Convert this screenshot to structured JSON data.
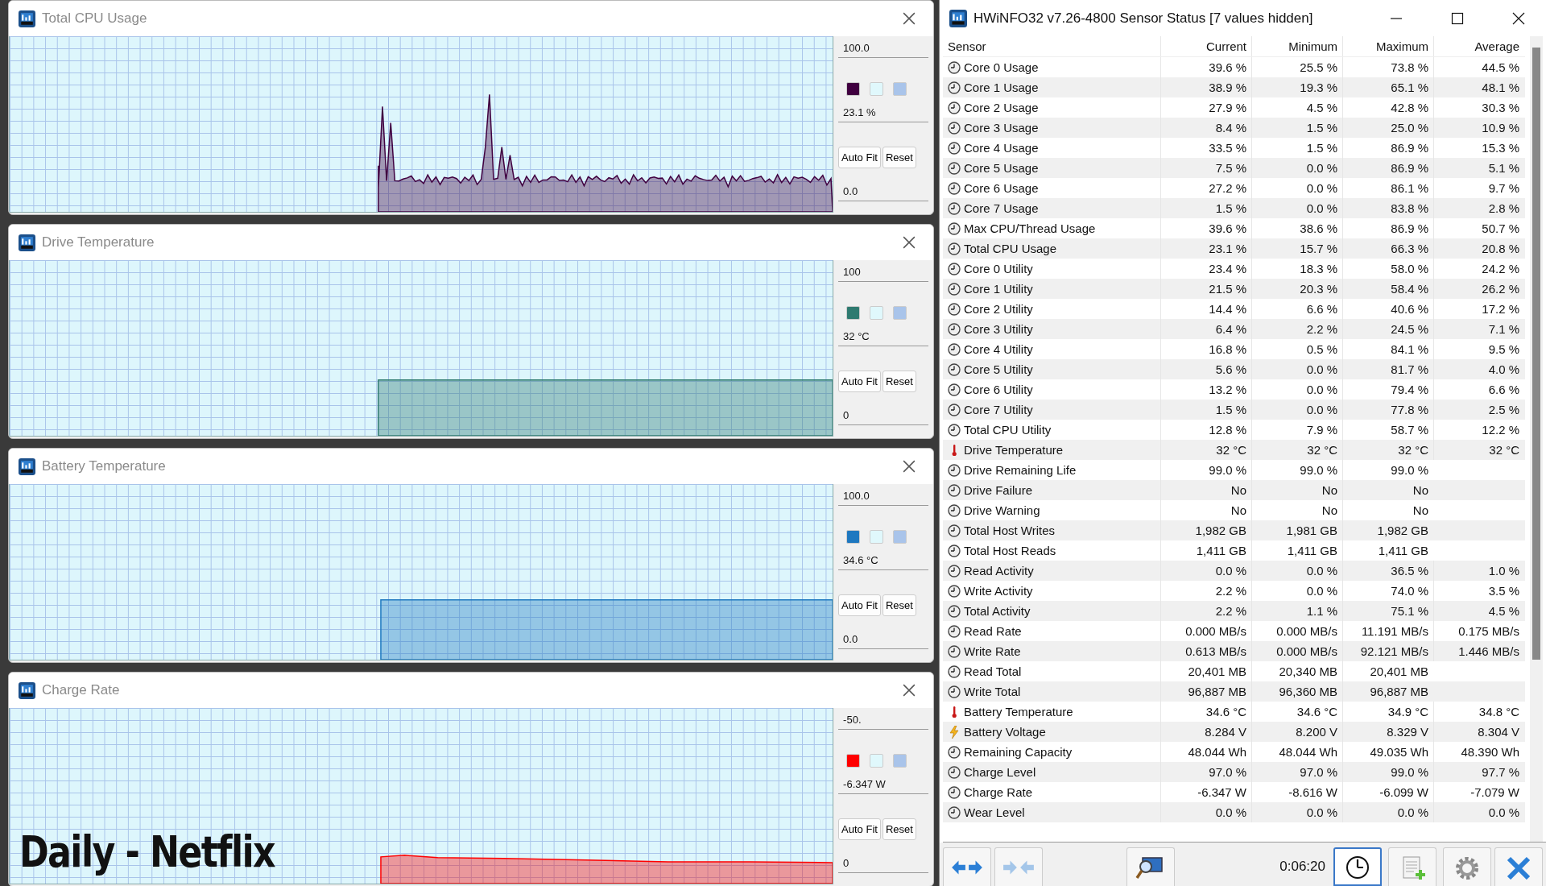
{
  "graphs": [
    {
      "title": "Total CPU Usage",
      "max_label": "100.0",
      "current": "23.1 %",
      "min_label": "0.0",
      "color": "#400040",
      "buttons": [
        "Auto Fit",
        "Reset"
      ]
    },
    {
      "title": "Drive Temperature",
      "max_label": "100",
      "current": "32 °C",
      "min_label": "0",
      "color": "#2e7a70",
      "buttons": [
        "Auto Fit",
        "Reset"
      ]
    },
    {
      "title": "Battery Temperature",
      "max_label": "100.0",
      "current": "34.6 °C",
      "min_label": "0.0",
      "color": "#1e78c0",
      "buttons": [
        "Auto Fit",
        "Reset"
      ]
    },
    {
      "title": "Charge Rate",
      "max_label": "-50.",
      "current": "-6.347 W",
      "min_label": "0",
      "color": "#ff0000",
      "buttons": [
        "Auto Fit",
        "Reset"
      ],
      "caption": "Daily - Netflix"
    }
  ],
  "sensor_window": {
    "title": "HWiNFO32 v7.26-4800 Sensor Status [7 values hidden]",
    "columns": [
      "Sensor",
      "Current",
      "Minimum",
      "Maximum",
      "Average"
    ],
    "rows": [
      {
        "kind": "gauge",
        "name": "Core 0 Usage",
        "current": "39.6 %",
        "minimum": "25.5 %",
        "maximum": "73.8 %",
        "average": "44.5 %"
      },
      {
        "kind": "gauge",
        "name": "Core 1 Usage",
        "current": "38.9 %",
        "minimum": "19.3 %",
        "maximum": "65.1 %",
        "average": "48.1 %"
      },
      {
        "kind": "gauge",
        "name": "Core 2 Usage",
        "current": "27.9 %",
        "minimum": "4.5 %",
        "maximum": "42.8 %",
        "average": "30.3 %"
      },
      {
        "kind": "gauge",
        "name": "Core 3 Usage",
        "current": "8.4 %",
        "minimum": "1.5 %",
        "maximum": "25.0 %",
        "average": "10.9 %"
      },
      {
        "kind": "gauge",
        "name": "Core 4 Usage",
        "current": "33.5 %",
        "minimum": "1.5 %",
        "maximum": "86.9 %",
        "average": "15.3 %"
      },
      {
        "kind": "gauge",
        "name": "Core 5 Usage",
        "current": "7.5 %",
        "minimum": "0.0 %",
        "maximum": "86.9 %",
        "average": "5.1 %"
      },
      {
        "kind": "gauge",
        "name": "Core 6 Usage",
        "current": "27.2 %",
        "minimum": "0.0 %",
        "maximum": "86.1 %",
        "average": "9.7 %"
      },
      {
        "kind": "gauge",
        "name": "Core 7 Usage",
        "current": "1.5 %",
        "minimum": "0.0 %",
        "maximum": "83.8 %",
        "average": "2.8 %"
      },
      {
        "kind": "gauge",
        "name": "Max CPU/Thread Usage",
        "current": "39.6 %",
        "minimum": "38.6 %",
        "maximum": "86.9 %",
        "average": "50.7 %"
      },
      {
        "kind": "gauge",
        "name": "Total CPU Usage",
        "current": "23.1 %",
        "minimum": "15.7 %",
        "maximum": "66.3 %",
        "average": "20.8 %"
      },
      {
        "kind": "gauge",
        "name": "Core 0 Utility",
        "current": "23.4 %",
        "minimum": "18.3 %",
        "maximum": "58.0 %",
        "average": "24.2 %"
      },
      {
        "kind": "gauge",
        "name": "Core 1 Utility",
        "current": "21.5 %",
        "minimum": "20.3 %",
        "maximum": "58.4 %",
        "average": "26.2 %"
      },
      {
        "kind": "gauge",
        "name": "Core 2 Utility",
        "current": "14.4 %",
        "minimum": "6.6 %",
        "maximum": "40.6 %",
        "average": "17.2 %"
      },
      {
        "kind": "gauge",
        "name": "Core 3 Utility",
        "current": "6.4 %",
        "minimum": "2.2 %",
        "maximum": "24.5 %",
        "average": "7.1 %"
      },
      {
        "kind": "gauge",
        "name": "Core 4 Utility",
        "current": "16.8 %",
        "minimum": "0.5 %",
        "maximum": "84.1 %",
        "average": "9.5 %"
      },
      {
        "kind": "gauge",
        "name": "Core 5 Utility",
        "current": "5.6 %",
        "minimum": "0.0 %",
        "maximum": "81.7 %",
        "average": "4.0 %"
      },
      {
        "kind": "gauge",
        "name": "Core 6 Utility",
        "current": "13.2 %",
        "minimum": "0.0 %",
        "maximum": "79.4 %",
        "average": "6.6 %"
      },
      {
        "kind": "gauge",
        "name": "Core 7 Utility",
        "current": "1.5 %",
        "minimum": "0.0 %",
        "maximum": "77.8 %",
        "average": "2.5 %"
      },
      {
        "kind": "gauge",
        "name": "Total CPU Utility",
        "current": "12.8 %",
        "minimum": "7.9 %",
        "maximum": "58.7 %",
        "average": "12.2 %"
      },
      {
        "kind": "temperature",
        "name": "Drive Temperature",
        "current": "32 °C",
        "minimum": "32 °C",
        "maximum": "32 °C",
        "average": "32 °C"
      },
      {
        "kind": "gauge",
        "name": "Drive Remaining Life",
        "current": "99.0 %",
        "minimum": "99.0 %",
        "maximum": "99.0 %"
      },
      {
        "kind": "gauge",
        "name": "Drive Failure",
        "current": "No",
        "minimum": "No",
        "maximum": "No"
      },
      {
        "kind": "gauge",
        "name": "Drive Warning",
        "current": "No",
        "minimum": "No",
        "maximum": "No"
      },
      {
        "kind": "gauge",
        "name": "Total Host Writes",
        "current": "1,982 GB",
        "minimum": "1,981 GB",
        "maximum": "1,982 GB"
      },
      {
        "kind": "gauge",
        "name": "Total Host Reads",
        "current": "1,411 GB",
        "minimum": "1,411 GB",
        "maximum": "1,411 GB"
      },
      {
        "kind": "gauge",
        "name": "Read Activity",
        "current": "0.0 %",
        "minimum": "0.0 %",
        "maximum": "36.5 %",
        "average": "1.0 %"
      },
      {
        "kind": "gauge",
        "name": "Write Activity",
        "current": "2.2 %",
        "minimum": "0.0 %",
        "maximum": "74.0 %",
        "average": "3.5 %"
      },
      {
        "kind": "gauge",
        "name": "Total Activity",
        "current": "2.2 %",
        "minimum": "1.1 %",
        "maximum": "75.1 %",
        "average": "4.5 %"
      },
      {
        "kind": "gauge",
        "name": "Read Rate",
        "current": "0.000 MB/s",
        "minimum": "0.000 MB/s",
        "maximum": "11.191 MB/s",
        "average": "0.175 MB/s"
      },
      {
        "kind": "gauge",
        "name": "Write Rate",
        "current": "0.613 MB/s",
        "minimum": "0.000 MB/s",
        "maximum": "92.121 MB/s",
        "average": "1.446 MB/s"
      },
      {
        "kind": "gauge",
        "name": "Read Total",
        "current": "20,401 MB",
        "minimum": "20,340 MB",
        "maximum": "20,401 MB"
      },
      {
        "kind": "gauge",
        "name": "Write Total",
        "current": "96,887 MB",
        "minimum": "96,360 MB",
        "maximum": "96,887 MB"
      },
      {
        "kind": "temperature",
        "name": "Battery Temperature",
        "current": "34.6 °C",
        "minimum": "34.6 °C",
        "maximum": "34.9 °C",
        "average": "34.8 °C"
      },
      {
        "kind": "voltage",
        "name": "Battery Voltage",
        "current": "8.284 V",
        "minimum": "8.200 V",
        "maximum": "8.329 V",
        "average": "8.304 V"
      },
      {
        "kind": "gauge",
        "name": "Remaining Capacity",
        "current": "48.044 Wh",
        "minimum": "48.044 Wh",
        "maximum": "49.035 Wh",
        "average": "48.390 Wh"
      },
      {
        "kind": "gauge",
        "name": "Charge Level",
        "current": "97.0 %",
        "minimum": "97.0 %",
        "maximum": "99.0 %",
        "average": "97.7 %"
      },
      {
        "kind": "gauge",
        "name": "Charge Rate",
        "current": "-6.347 W",
        "minimum": "-8.616 W",
        "maximum": "-6.099 W",
        "average": "-7.079 W"
      },
      {
        "kind": "gauge",
        "name": "Wear Level",
        "current": "0.0 %",
        "minimum": "0.0 %",
        "maximum": "0.0 %",
        "average": "0.0 %"
      }
    ],
    "toolbar": [
      {
        "kind": "expand",
        "disabled": false,
        "selected": false
      },
      {
        "kind": "collapse",
        "disabled": true,
        "selected": false
      },
      {
        "kind": "network",
        "disabled": false,
        "selected": false
      },
      {
        "kind": "elapsed",
        "text": "0:06:20"
      },
      {
        "kind": "clock",
        "disabled": false,
        "selected": true
      },
      {
        "kind": "report",
        "disabled": false,
        "selected": false
      },
      {
        "kind": "settings",
        "disabled": false,
        "selected": false
      },
      {
        "kind": "close",
        "disabled": false,
        "selected": false
      }
    ]
  }
}
